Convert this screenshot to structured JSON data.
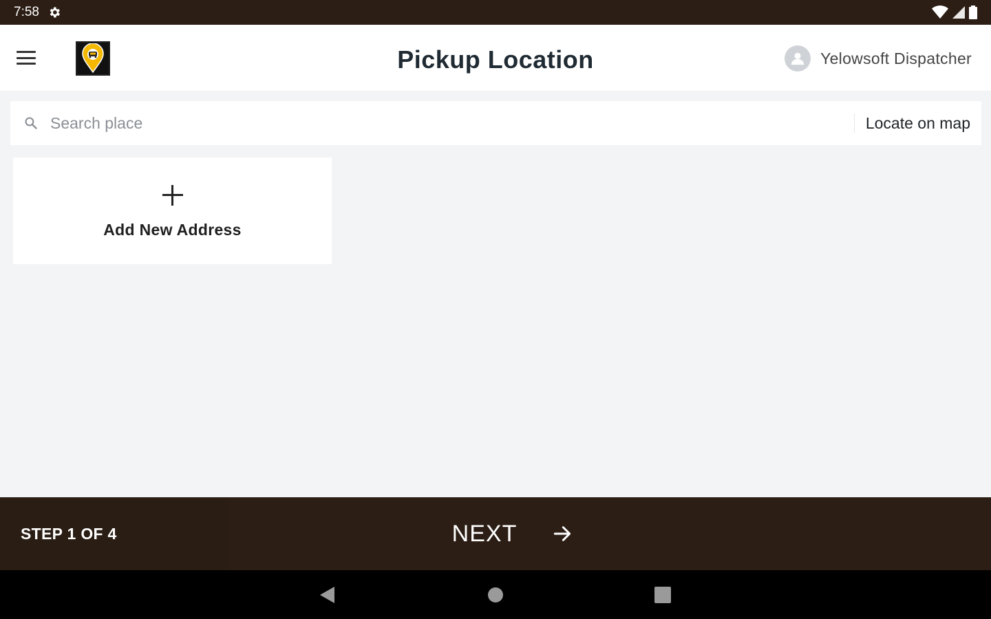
{
  "status_bar": {
    "time": "7:58",
    "icons": [
      "settings-icon",
      "wifi-icon",
      "signal-icon",
      "battery-icon"
    ]
  },
  "header": {
    "title": "Pickup Location",
    "user_name": "Yelowsoft Dispatcher",
    "menu_icon": "hamburger-menu-icon",
    "logo": "app-logo-icon"
  },
  "search": {
    "placeholder": "Search place",
    "value": "",
    "locate_label": "Locate on map"
  },
  "addresses": {
    "add_label": "Add New Address"
  },
  "footer": {
    "step_text": "STEP 1 OF 4",
    "next_label": "NEXT"
  },
  "colors": {
    "dark_brown": "#2c1e15",
    "background": "#f3f4f6",
    "accent_yellow": "#f5b800"
  }
}
